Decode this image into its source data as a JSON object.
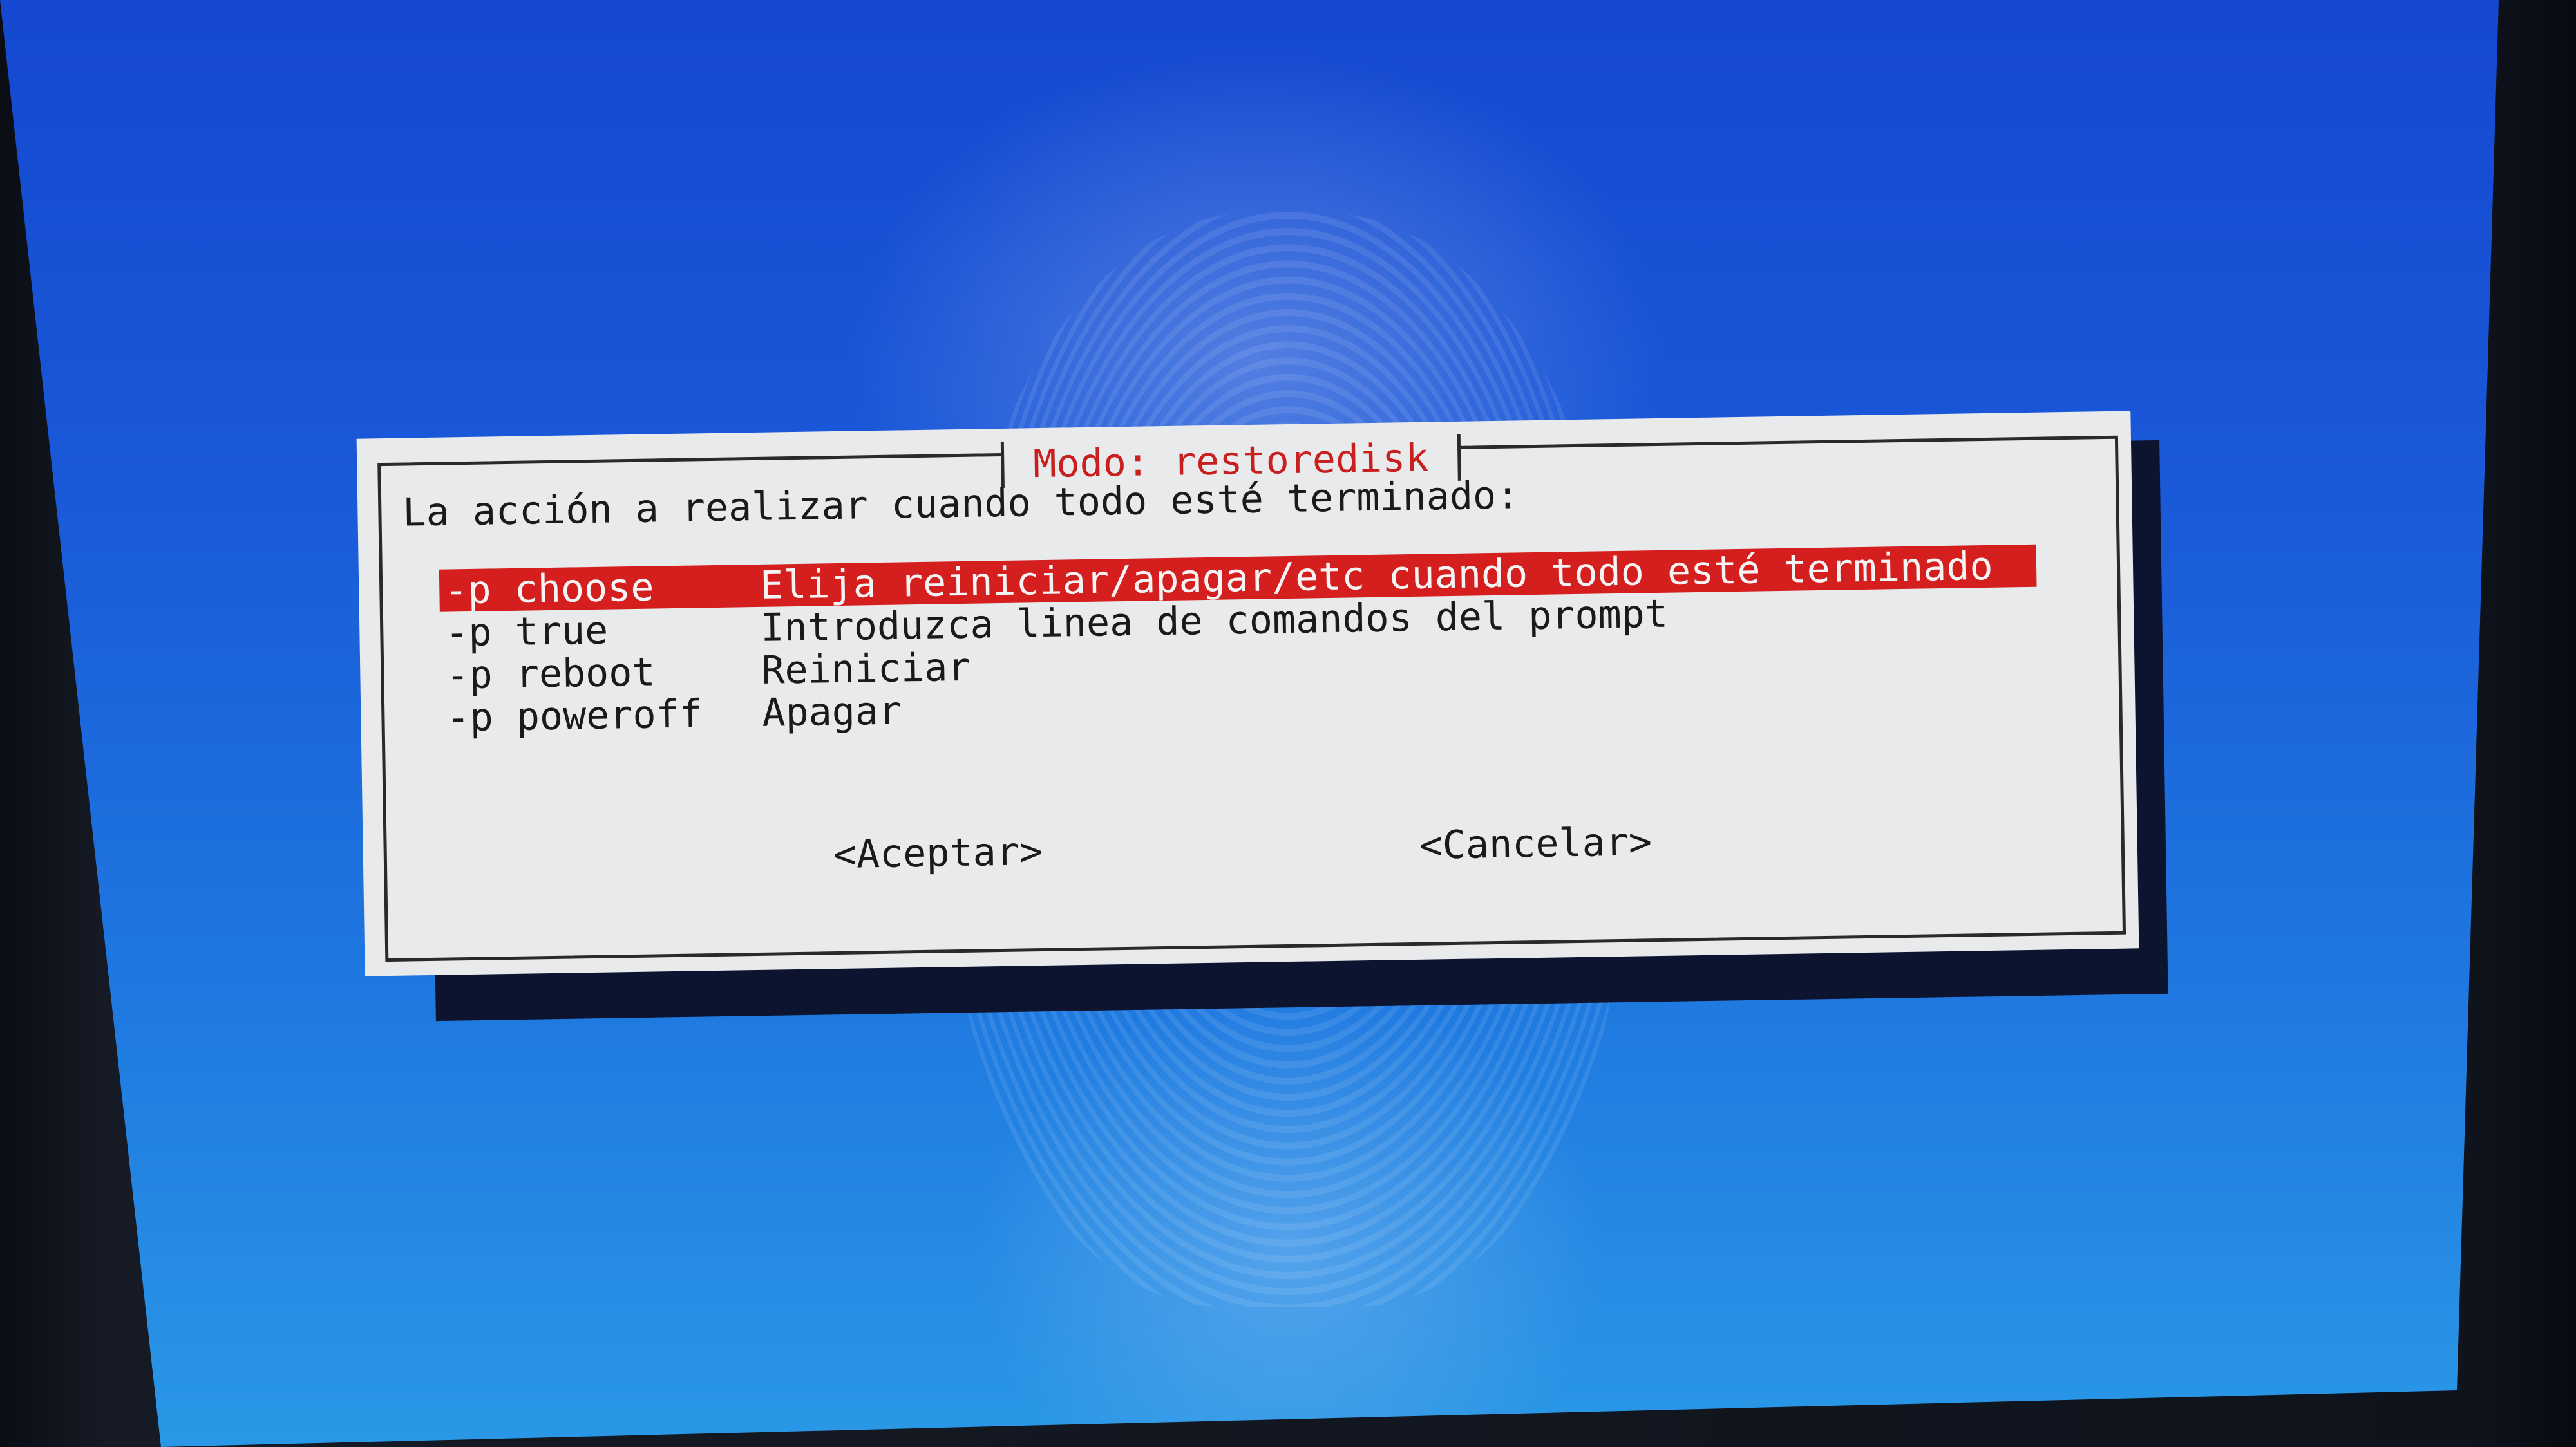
{
  "dialog": {
    "title": "Modo: restoredisk",
    "question": "La acción a realizar cuando todo esté terminado:",
    "options": [
      {
        "tag": "-p choose",
        "desc": "Elija reiniciar/apagar/etc cuando todo esté terminado",
        "selected": true
      },
      {
        "tag": "-p true",
        "desc": "Introduzca linea de comandos del prompt",
        "selected": false
      },
      {
        "tag": "-p reboot",
        "desc": "Reiniciar",
        "selected": false
      },
      {
        "tag": "-p poweroff",
        "desc": "Apagar",
        "selected": false
      }
    ],
    "accept_label": "<Aceptar>",
    "cancel_label": "<Cancelar>"
  },
  "colors": {
    "background": "#1a5ad9",
    "dialog": "#e9eaec",
    "selection": "#d51f1f",
    "title": "#c81f1f"
  }
}
